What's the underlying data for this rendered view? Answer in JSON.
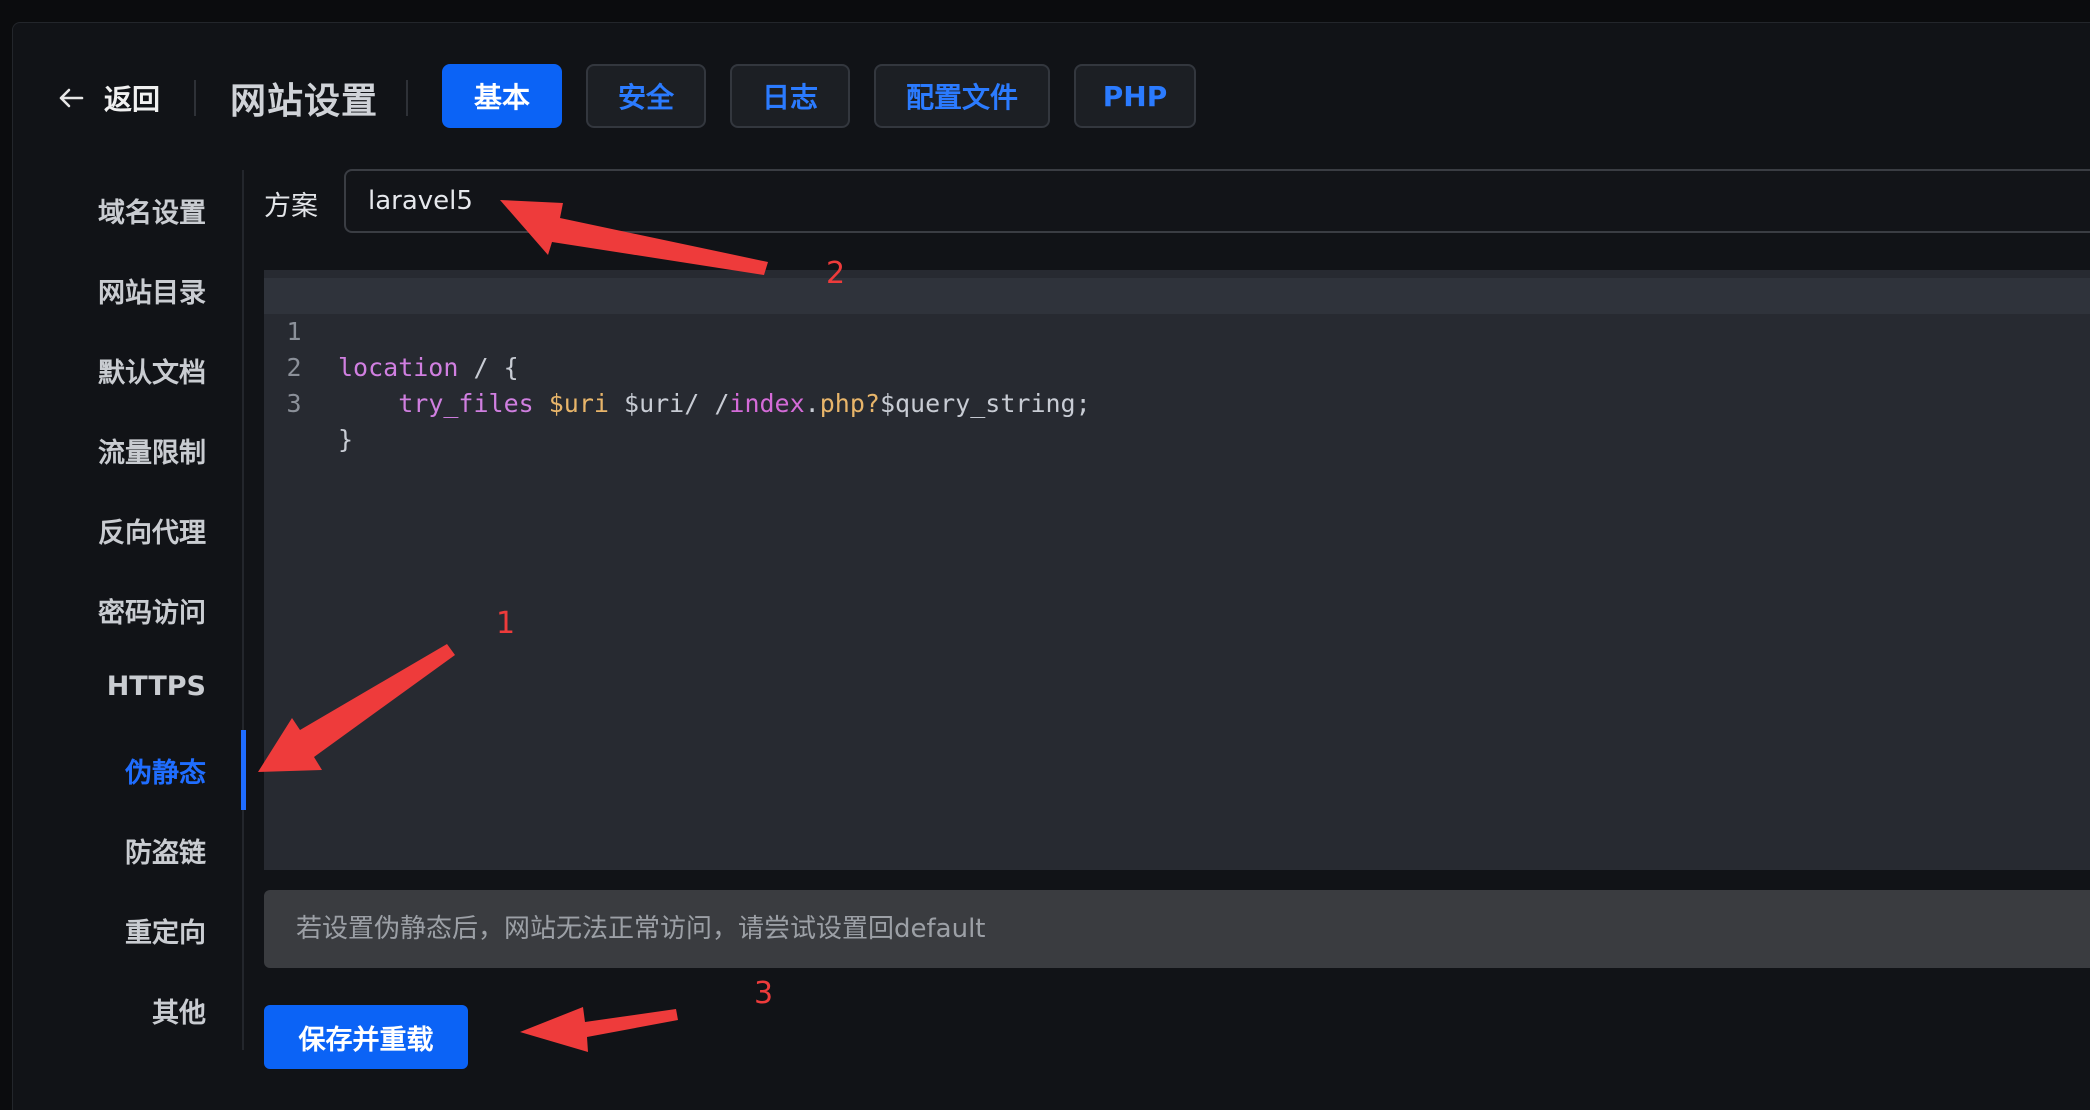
{
  "header": {
    "back_label": "返回",
    "title": "网站设置",
    "tabs": [
      {
        "label": "基本",
        "active": true
      },
      {
        "label": "安全",
        "active": false
      },
      {
        "label": "日志",
        "active": false
      },
      {
        "label": "配置文件",
        "active": false
      },
      {
        "label": "PHP",
        "active": false
      }
    ]
  },
  "sidebar": {
    "items": [
      {
        "label": "域名设置"
      },
      {
        "label": "网站目录"
      },
      {
        "label": "默认文档"
      },
      {
        "label": "流量限制"
      },
      {
        "label": "反向代理"
      },
      {
        "label": "密码访问"
      },
      {
        "label": "HTTPS"
      },
      {
        "label": "伪静态",
        "active": true
      },
      {
        "label": "防盗链"
      },
      {
        "label": "重定向"
      },
      {
        "label": "其他"
      }
    ]
  },
  "scheme": {
    "label": "方案",
    "value": "laravel5"
  },
  "editor": {
    "lines": [
      {
        "number": "1",
        "keyword": "location",
        "rest": " / {"
      },
      {
        "number": "2",
        "indent": "    ",
        "fn": "try_files",
        "space1": " ",
        "var1": "$uri",
        "plain1": " $uri/ /",
        "path": "index",
        "dot": ".",
        "ext": "php?",
        "plain2": "$query_string;"
      },
      {
        "number": "3",
        "rest": "}"
      }
    ]
  },
  "notice": "若设置伪静态后，网站无法正常访问，请尝试设置回default",
  "save_button": "保存并重载",
  "annotations": {
    "one": "1",
    "two": "2",
    "three": "3"
  },
  "colors": {
    "accent": "#0b63f6",
    "annotation": "#ee3b3b"
  }
}
